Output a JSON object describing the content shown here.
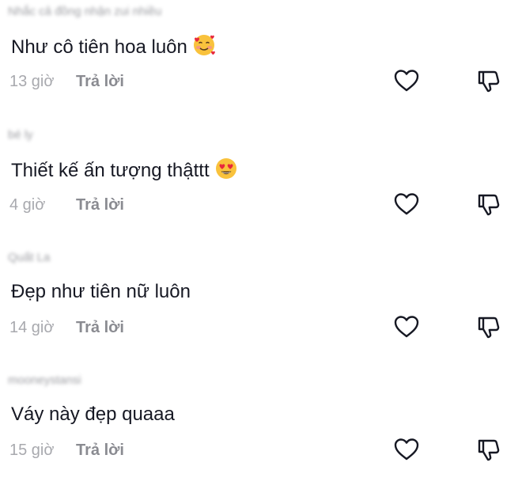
{
  "comments": [
    {
      "username": "Nhắc cả đồng nhận zui nhiều",
      "text": "Như cô tiên hoa luôn",
      "emoji": "smiling-face-with-hearts",
      "time": "13 giờ",
      "reply_label": "Trả lời"
    },
    {
      "username": "bé ly",
      "text": "Thiết kế ấn tượng thậttt",
      "emoji": "heart-eyes",
      "time": "4 giờ",
      "reply_label": "Trả lời"
    },
    {
      "username": "Quất La",
      "text": "Đẹp như tiên nữ luôn",
      "emoji": "",
      "time": "14 giờ",
      "reply_label": "Trả lời"
    },
    {
      "username": "mooneystansi",
      "text": "Váy này đẹp quaaa",
      "emoji": "",
      "time": "15 giờ",
      "reply_label": "Trả lời"
    }
  ],
  "icons": {
    "like": "heart-outline-icon",
    "dislike": "thumbs-down-icon"
  },
  "colors": {
    "text": "#161823",
    "meta": "#a8a9ae",
    "reply": "#8a8b91",
    "icon": "#161823"
  }
}
